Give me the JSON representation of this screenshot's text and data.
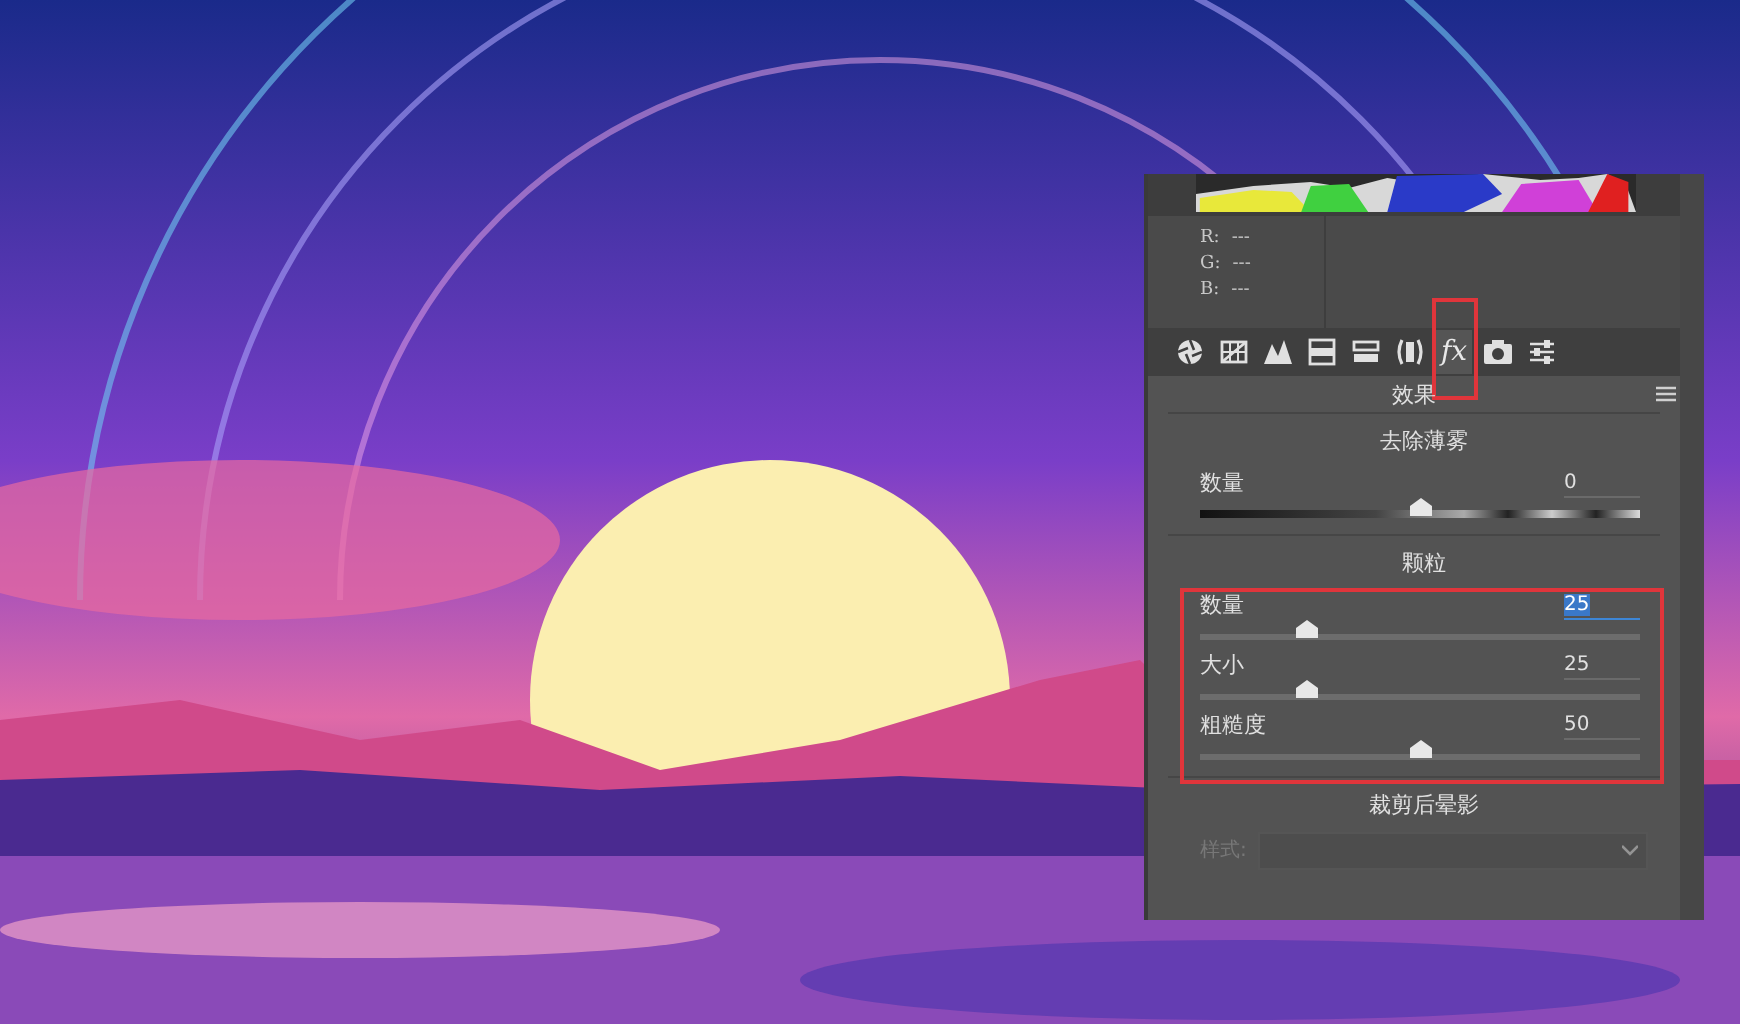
{
  "readout": [
    {
      "channel": "R:",
      "value": "---"
    },
    {
      "channel": "G:",
      "value": "---"
    },
    {
      "channel": "B:",
      "value": "---"
    }
  ],
  "tabs": [
    {
      "kind": "aperture",
      "selected": false,
      "highlighted": false
    },
    {
      "kind": "grid",
      "selected": false,
      "highlighted": false
    },
    {
      "kind": "peaks",
      "selected": false,
      "highlighted": false
    },
    {
      "kind": "bands",
      "selected": false,
      "highlighted": false
    },
    {
      "kind": "split",
      "selected": false,
      "highlighted": false
    },
    {
      "kind": "lens",
      "selected": false,
      "highlighted": false
    },
    {
      "kind": "text",
      "label": "fx",
      "selected": true,
      "highlighted": true
    },
    {
      "kind": "camera",
      "selected": false,
      "highlighted": false
    },
    {
      "kind": "sliders",
      "selected": false,
      "highlighted": false
    }
  ],
  "panel_title": "效果",
  "sections": [
    {
      "title": "去除薄雾",
      "highlighted": false,
      "kind": "gradient-slider",
      "sliders": [
        {
          "label": "数量",
          "value": "0",
          "level": 0.5,
          "value_selected": false
        }
      ]
    },
    {
      "title": "颗粒",
      "highlighted": true,
      "kind": "slider",
      "sliders": [
        {
          "label": "数量",
          "value": "25",
          "level": 0.24,
          "value_selected": true
        },
        {
          "label": "大小",
          "value": "25",
          "level": 0.24,
          "value_selected": false
        },
        {
          "label": "粗糙度",
          "value": "50",
          "level": 0.5,
          "value_selected": false
        }
      ]
    },
    {
      "title": "裁剪后晕影",
      "highlighted": false,
      "kind": "dropdown",
      "style_field": {
        "label": "样式:",
        "disabled": true
      }
    }
  ]
}
